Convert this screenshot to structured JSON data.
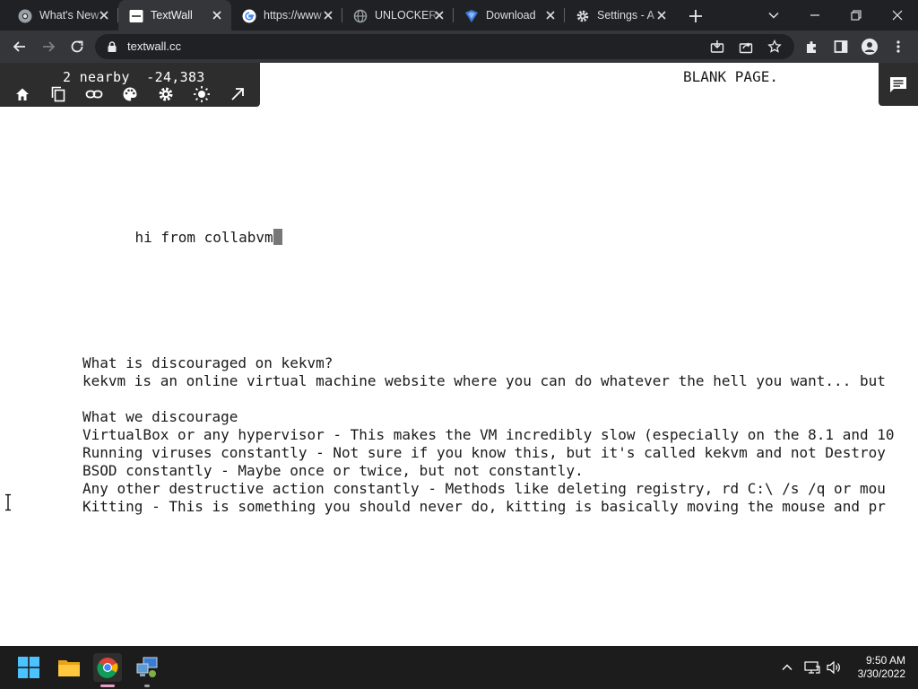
{
  "browser": {
    "tabs": [
      {
        "title": "What's New",
        "icon": "chrome-icon"
      },
      {
        "title": "TextWall",
        "icon": "textwall-favicon",
        "active": true
      },
      {
        "title": "https://www",
        "icon": "google-icon"
      },
      {
        "title": "UNLOCKER",
        "icon": "globe-icon"
      },
      {
        "title": "Download",
        "icon": "download-site-icon"
      },
      {
        "title": "Settings - A",
        "icon": "gear-icon"
      }
    ],
    "url": "textwall.cc"
  },
  "textwall": {
    "coords": "2 nearby  -24,383",
    "tools": [
      "home-icon",
      "copy-icon",
      "link-icon",
      "palette-icon",
      "gear-icon",
      "brightness-icon",
      "expand-icon"
    ]
  },
  "page": {
    "blank_label": "BLANK PAGE.",
    "greeting": "hi from collabvm",
    "lines": [
      "What is discouraged on kekvm?",
      "kekvm is an online virtual machine website where you can do whatever the hell you want... but",
      "",
      "What we discourage",
      "VirtualBox or any hypervisor - This makes the VM incredibly slow (especially on the 8.1 and 10",
      "Running viruses constantly - Not sure if you know this, but it's called kekvm and not Destroy",
      "BSOD constantly - Maybe once or twice, but not constantly.",
      "Any other destructive action constantly - Methods like deleting registry, rd C:\\ /s /q or mou",
      "Kitting - This is something you should never do, kitting is basically moving the mouse and pr"
    ]
  },
  "taskbar": {
    "time": "9:50 AM",
    "date": "3/30/2022"
  },
  "colors": {
    "chrome_dark": "#202124",
    "chrome_toolbar": "#35363a",
    "textwall_panel": "#2d2d2d",
    "taskbar": "#1c1c1c"
  }
}
